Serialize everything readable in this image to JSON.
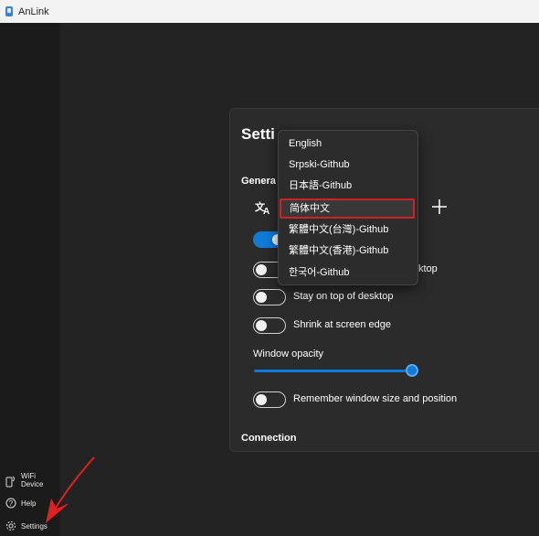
{
  "window": {
    "title": "AnLink"
  },
  "sidebar": {
    "items": [
      {
        "label": "WiFi Device",
        "line1": "WiFi",
        "line2": "Device",
        "icon": "wifi-device-icon"
      },
      {
        "label": "Help",
        "icon": "help-icon"
      },
      {
        "label": "Settings",
        "icon": "gear-icon"
      }
    ]
  },
  "settings": {
    "title": "Setti",
    "general_label": "Genera",
    "language_icon": "translate-icon",
    "add_icon": "plus-icon",
    "toggles": [
      {
        "label": "",
        "on": true
      },
      {
        "label": "ktop",
        "on": false
      },
      {
        "label": "Stay on top of desktop",
        "on": false
      },
      {
        "label": "Shrink at screen edge",
        "on": false
      }
    ],
    "opacity_label": "Window opacity",
    "opacity_value": 0.9,
    "remember_label": "Remember window size and position",
    "remember_on": false,
    "connection_label": "Connection"
  },
  "language_menu": {
    "items": [
      "English",
      "Srpski-Github",
      "日本語-Github",
      "简体中文",
      "繁體中文(台灣)-Github",
      "繁體中文(香港)-Github",
      "한국어-Github"
    ],
    "selected_index": 3
  },
  "colors": {
    "accent": "#0f7ad8",
    "highlight_border": "#d2202a",
    "annotation_arrow": "#e02020"
  }
}
